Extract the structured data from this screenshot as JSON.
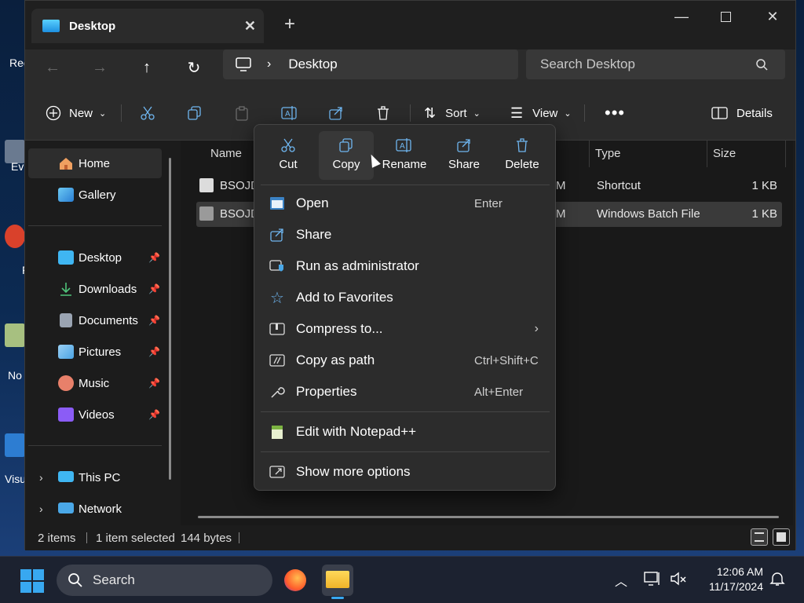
{
  "desktop": {
    "icons": [
      {
        "label": "Rec"
      },
      {
        "label": "Ev"
      },
      {
        "label": "F"
      },
      {
        "label": "No"
      },
      {
        "label": "Visu"
      }
    ]
  },
  "window": {
    "tab_title": "Desktop",
    "address": {
      "crumb": "Desktop"
    },
    "search_placeholder": "Search Desktop",
    "toolbar": {
      "new_label": "New",
      "sort_label": "Sort",
      "view_label": "View",
      "details_label": "Details"
    },
    "sidebar": {
      "home": "Home",
      "gallery": "Gallery",
      "pinned": [
        {
          "label": "Desktop",
          "icon": "desktop-folder-icon",
          "color": "#3fb6f2"
        },
        {
          "label": "Downloads",
          "icon": "download-icon",
          "color": "#4fc37a"
        },
        {
          "label": "Documents",
          "icon": "document-icon",
          "color": "#9aa4b2"
        },
        {
          "label": "Pictures",
          "icon": "pictures-icon",
          "color": "#4ba3e3"
        },
        {
          "label": "Music",
          "icon": "music-icon",
          "color": "#e8806a"
        },
        {
          "label": "Videos",
          "icon": "video-icon",
          "color": "#8b5cf6"
        }
      ],
      "this_pc": "This PC",
      "network": "Network"
    },
    "columns": {
      "name": "Name",
      "type": "Type",
      "size": "Size"
    },
    "files": [
      {
        "name": "BSOJD",
        "date_tail": "M",
        "type": "Shortcut",
        "size": "1 KB"
      },
      {
        "name": "BSOJD",
        "date_tail": "M",
        "type": "Windows Batch File",
        "size": "1 KB"
      }
    ],
    "status": {
      "items": "2 items",
      "selected": "1 item selected",
      "size": "144 bytes"
    }
  },
  "context_menu": {
    "quick_actions": [
      {
        "label": "Cut"
      },
      {
        "label": "Copy"
      },
      {
        "label": "Rename"
      },
      {
        "label": "Share"
      },
      {
        "label": "Delete"
      }
    ],
    "items": [
      {
        "label": "Open",
        "shortcut": "Enter"
      },
      {
        "label": "Share",
        "shortcut": ""
      },
      {
        "label": "Run as administrator",
        "shortcut": ""
      },
      {
        "label": "Add to Favorites",
        "shortcut": ""
      },
      {
        "label": "Compress to...",
        "shortcut": ""
      },
      {
        "label": "Copy as path",
        "shortcut": "Ctrl+Shift+C"
      },
      {
        "label": "Properties",
        "shortcut": "Alt+Enter"
      },
      {
        "label": "Edit with Notepad++",
        "shortcut": ""
      },
      {
        "label": "Show more options",
        "shortcut": ""
      }
    ]
  },
  "taskbar": {
    "search_label": "Search",
    "time": "12:06 AM",
    "date": "11/17/2024"
  },
  "colors": {
    "accent": "#38a8f0",
    "window_bg": "#1c1c1c",
    "menu_bg": "#2c2c2c"
  }
}
